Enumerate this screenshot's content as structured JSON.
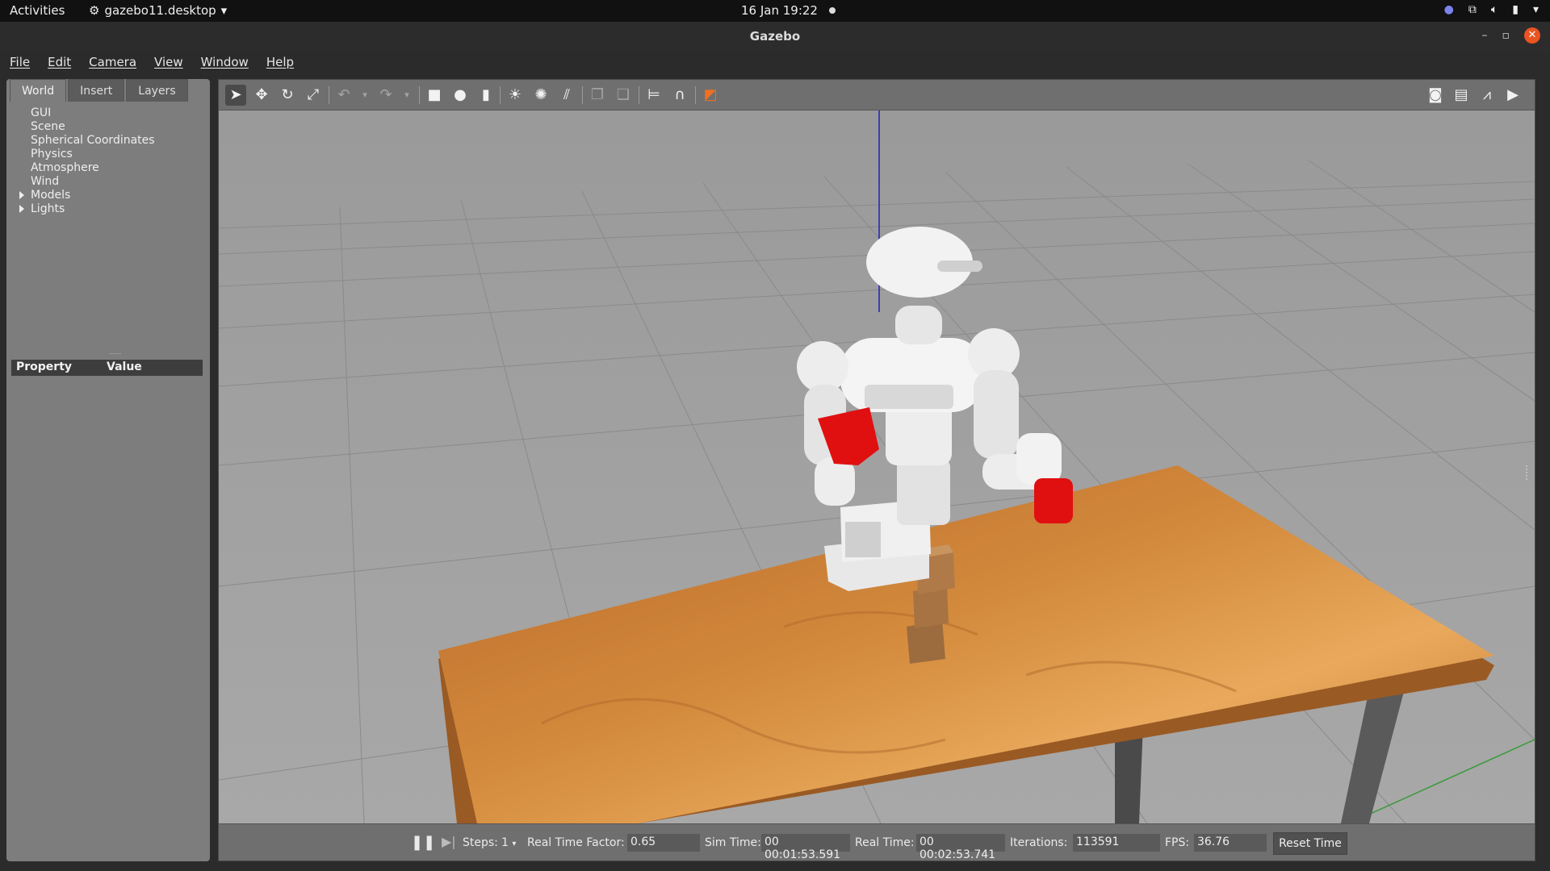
{
  "topbar": {
    "activities": "Activities",
    "app_menu": "gazebo11.desktop",
    "clock": "16 Jan  19:22"
  },
  "window": {
    "title": "Gazebo"
  },
  "menu": [
    "File",
    "Edit",
    "Camera",
    "View",
    "Window",
    "Help"
  ],
  "left_panel": {
    "tabs": [
      "World",
      "Insert",
      "Layers"
    ],
    "active_tab": "World",
    "tree": [
      {
        "label": "GUI",
        "expandable": false
      },
      {
        "label": "Scene",
        "expandable": false
      },
      {
        "label": "Spherical Coordinates",
        "expandable": false
      },
      {
        "label": "Physics",
        "expandable": false
      },
      {
        "label": "Atmosphere",
        "expandable": false
      },
      {
        "label": "Wind",
        "expandable": false
      },
      {
        "label": "Models",
        "expandable": true
      },
      {
        "label": "Lights",
        "expandable": true
      }
    ],
    "property_header": {
      "property": "Property",
      "value": "Value"
    }
  },
  "toolbar": {
    "icons": [
      "select-icon",
      "translate-icon",
      "rotate-icon",
      "scale-icon",
      "undo-icon",
      "redo-icon",
      "box-icon",
      "sphere-icon",
      "cylinder-icon",
      "point-light-icon",
      "spot-light-icon",
      "directional-light-icon",
      "copy-icon",
      "paste-icon",
      "align-icon",
      "snap-icon",
      "view-angle-icon",
      "screenshot-icon",
      "log-icon",
      "plot-icon",
      "record-icon"
    ]
  },
  "bottom_bar": {
    "steps_label": "Steps:",
    "steps_value": "1",
    "rtf_label": "Real Time Factor:",
    "rtf_value": "0.65",
    "sim_time_label": "Sim Time:",
    "sim_time_value": "00 00:01:53.591",
    "real_time_label": "Real Time:",
    "real_time_value": "00 00:02:53.741",
    "iterations_label": "Iterations:",
    "iterations_value": "113591",
    "fps_label": "FPS:",
    "fps_value": "36.76",
    "reset_label": "Reset Time"
  },
  "colors": {
    "accent_close": "#e95420",
    "robot_gripper": "#e01010",
    "table_wood": "#c8782e",
    "viewport_bg": "#a4a4a4"
  }
}
